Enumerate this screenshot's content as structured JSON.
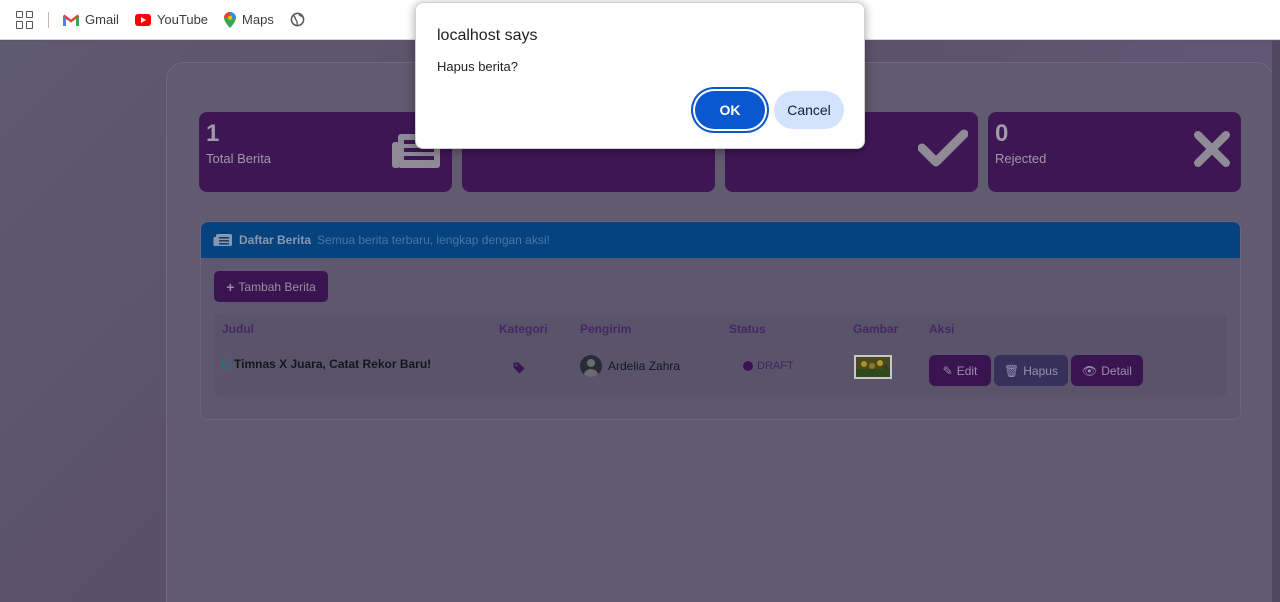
{
  "bookmarks": [
    {
      "label": "Gmail",
      "icon": "gmail-icon"
    },
    {
      "label": "YouTube",
      "icon": "youtube-icon"
    },
    {
      "label": "Maps",
      "icon": "maps-icon"
    }
  ],
  "stats": [
    {
      "value": "1",
      "label": "Total Berita",
      "icon": "newspaper-icon"
    },
    {
      "value": "",
      "label": "",
      "icon": ""
    },
    {
      "value": "",
      "label": "",
      "icon": "check-icon"
    },
    {
      "value": "0",
      "label": "Rejected",
      "icon": "x-icon"
    }
  ],
  "list": {
    "title": "Daftar Berita",
    "subtitle": "Semua berita terbaru, lengkap dengan aksi!",
    "add_button": "Tambah Berita",
    "columns": [
      "Judul",
      "Kategori",
      "Pengirim",
      "Status",
      "Gambar",
      "Aksi"
    ],
    "rows": [
      {
        "judul": "Timnas X Juara, Catat Rekor Baru!",
        "pengirim": "Ardelia Zahra",
        "status": "DRAFT"
      }
    ],
    "actions": {
      "edit": "Edit",
      "hapus": "Hapus",
      "detail": "Detail"
    }
  },
  "dialog": {
    "title": "localhost says",
    "message": "Hapus berita?",
    "ok": "OK",
    "cancel": "Cancel"
  },
  "colors": {
    "dialog_primary": "#0b57d0",
    "dialog_secondary": "#d3e3fd",
    "stat_card": "#3e1654",
    "list_header": "#06437e"
  }
}
